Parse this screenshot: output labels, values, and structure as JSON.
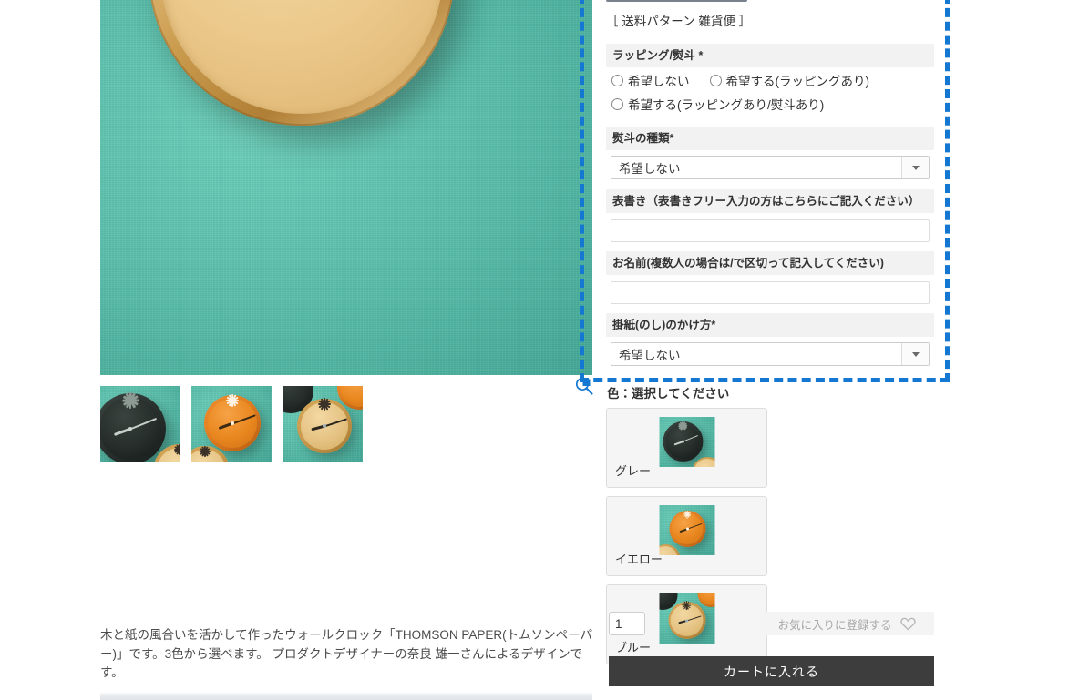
{
  "left": {
    "zoom_icon": "magnifier-zoom-icon",
    "main_image_alt": "THOMSON PAPER cream wall clock on teal wall",
    "thumbnails": [
      {
        "alt": "gray clock thumbnail",
        "variant": "dark"
      },
      {
        "alt": "orange clock thumbnail",
        "variant": "orange"
      },
      {
        "alt": "cream clock thumbnail",
        "variant": "cream"
      }
    ],
    "description": "木と紙の風合いを活かして作ったウォールクロック「THOMSON PAPER(トムソンペーパー)」です。3色から選べます。\nプロダクトデザイナーの奈良 雄一さんによるデザインです。"
  },
  "right": {
    "shipping_note": "［ 送料パターン 雑貨便 ］",
    "wrapping": {
      "label": "ラッピング/熨斗 *",
      "options": [
        "希望しない",
        "希望する(ラッピングあり)",
        "希望する(ラッピングあり/熨斗あり)"
      ]
    },
    "noshi_type": {
      "label": "熨斗の種類*",
      "value": "希望しない"
    },
    "omotegaki": {
      "label": "表書き（表書きフリー入力の方はこちらにご記入ください）",
      "value": "",
      "placeholder": ""
    },
    "name_field": {
      "label": "お名前(複数人の場合は/で区切って記入してください)",
      "value": "",
      "placeholder": ""
    },
    "kakegami": {
      "label": "掛紙(のし)のかけ方*",
      "value": "希望しない"
    },
    "color": {
      "title": "色：選択してください",
      "swatches": [
        {
          "label": "グレー",
          "variant": "dark"
        },
        {
          "label": "イエロー",
          "variant": "orange"
        },
        {
          "label": "ブルー",
          "variant": "cream"
        }
      ]
    },
    "quantity": {
      "value": "1"
    },
    "favorite": {
      "label": "お気に入りに登録する",
      "icon": "heart-outline-icon"
    },
    "cart": {
      "label": "カートに入れる"
    }
  },
  "colors": {
    "accent_selection": "#1478d2",
    "cart_button_bg": "#3d3d3d",
    "field_label_bg": "#f2f2f2",
    "swatch_bg": "#f5f5f5",
    "wall_teal": "#5fc4b0"
  }
}
